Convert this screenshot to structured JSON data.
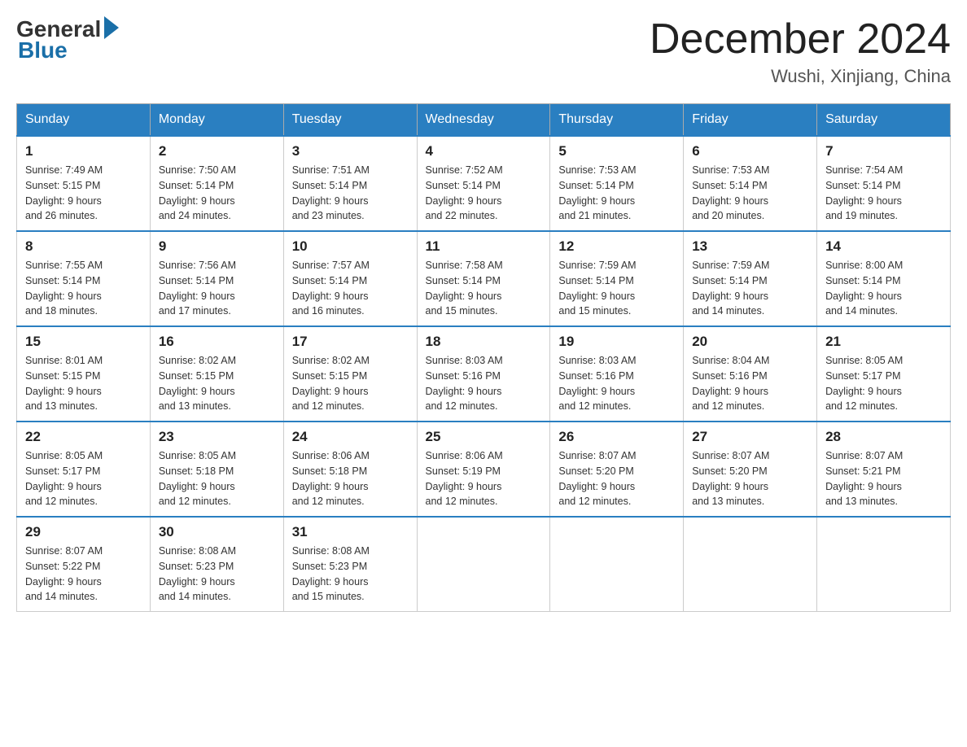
{
  "logo": {
    "general": "General",
    "blue": "Blue"
  },
  "title": "December 2024",
  "location": "Wushi, Xinjiang, China",
  "days_of_week": [
    "Sunday",
    "Monday",
    "Tuesday",
    "Wednesday",
    "Thursday",
    "Friday",
    "Saturday"
  ],
  "weeks": [
    [
      {
        "day": "1",
        "sunrise": "7:49 AM",
        "sunset": "5:15 PM",
        "daylight": "9 hours and 26 minutes."
      },
      {
        "day": "2",
        "sunrise": "7:50 AM",
        "sunset": "5:14 PM",
        "daylight": "9 hours and 24 minutes."
      },
      {
        "day": "3",
        "sunrise": "7:51 AM",
        "sunset": "5:14 PM",
        "daylight": "9 hours and 23 minutes."
      },
      {
        "day": "4",
        "sunrise": "7:52 AM",
        "sunset": "5:14 PM",
        "daylight": "9 hours and 22 minutes."
      },
      {
        "day": "5",
        "sunrise": "7:53 AM",
        "sunset": "5:14 PM",
        "daylight": "9 hours and 21 minutes."
      },
      {
        "day": "6",
        "sunrise": "7:53 AM",
        "sunset": "5:14 PM",
        "daylight": "9 hours and 20 minutes."
      },
      {
        "day": "7",
        "sunrise": "7:54 AM",
        "sunset": "5:14 PM",
        "daylight": "9 hours and 19 minutes."
      }
    ],
    [
      {
        "day": "8",
        "sunrise": "7:55 AM",
        "sunset": "5:14 PM",
        "daylight": "9 hours and 18 minutes."
      },
      {
        "day": "9",
        "sunrise": "7:56 AM",
        "sunset": "5:14 PM",
        "daylight": "9 hours and 17 minutes."
      },
      {
        "day": "10",
        "sunrise": "7:57 AM",
        "sunset": "5:14 PM",
        "daylight": "9 hours and 16 minutes."
      },
      {
        "day": "11",
        "sunrise": "7:58 AM",
        "sunset": "5:14 PM",
        "daylight": "9 hours and 15 minutes."
      },
      {
        "day": "12",
        "sunrise": "7:59 AM",
        "sunset": "5:14 PM",
        "daylight": "9 hours and 15 minutes."
      },
      {
        "day": "13",
        "sunrise": "7:59 AM",
        "sunset": "5:14 PM",
        "daylight": "9 hours and 14 minutes."
      },
      {
        "day": "14",
        "sunrise": "8:00 AM",
        "sunset": "5:14 PM",
        "daylight": "9 hours and 14 minutes."
      }
    ],
    [
      {
        "day": "15",
        "sunrise": "8:01 AM",
        "sunset": "5:15 PM",
        "daylight": "9 hours and 13 minutes."
      },
      {
        "day": "16",
        "sunrise": "8:02 AM",
        "sunset": "5:15 PM",
        "daylight": "9 hours and 13 minutes."
      },
      {
        "day": "17",
        "sunrise": "8:02 AM",
        "sunset": "5:15 PM",
        "daylight": "9 hours and 12 minutes."
      },
      {
        "day": "18",
        "sunrise": "8:03 AM",
        "sunset": "5:16 PM",
        "daylight": "9 hours and 12 minutes."
      },
      {
        "day": "19",
        "sunrise": "8:03 AM",
        "sunset": "5:16 PM",
        "daylight": "9 hours and 12 minutes."
      },
      {
        "day": "20",
        "sunrise": "8:04 AM",
        "sunset": "5:16 PM",
        "daylight": "9 hours and 12 minutes."
      },
      {
        "day": "21",
        "sunrise": "8:05 AM",
        "sunset": "5:17 PM",
        "daylight": "9 hours and 12 minutes."
      }
    ],
    [
      {
        "day": "22",
        "sunrise": "8:05 AM",
        "sunset": "5:17 PM",
        "daylight": "9 hours and 12 minutes."
      },
      {
        "day": "23",
        "sunrise": "8:05 AM",
        "sunset": "5:18 PM",
        "daylight": "9 hours and 12 minutes."
      },
      {
        "day": "24",
        "sunrise": "8:06 AM",
        "sunset": "5:18 PM",
        "daylight": "9 hours and 12 minutes."
      },
      {
        "day": "25",
        "sunrise": "8:06 AM",
        "sunset": "5:19 PM",
        "daylight": "9 hours and 12 minutes."
      },
      {
        "day": "26",
        "sunrise": "8:07 AM",
        "sunset": "5:20 PM",
        "daylight": "9 hours and 12 minutes."
      },
      {
        "day": "27",
        "sunrise": "8:07 AM",
        "sunset": "5:20 PM",
        "daylight": "9 hours and 13 minutes."
      },
      {
        "day": "28",
        "sunrise": "8:07 AM",
        "sunset": "5:21 PM",
        "daylight": "9 hours and 13 minutes."
      }
    ],
    [
      {
        "day": "29",
        "sunrise": "8:07 AM",
        "sunset": "5:22 PM",
        "daylight": "9 hours and 14 minutes."
      },
      {
        "day": "30",
        "sunrise": "8:08 AM",
        "sunset": "5:23 PM",
        "daylight": "9 hours and 14 minutes."
      },
      {
        "day": "31",
        "sunrise": "8:08 AM",
        "sunset": "5:23 PM",
        "daylight": "9 hours and 15 minutes."
      },
      null,
      null,
      null,
      null
    ]
  ],
  "labels": {
    "sunrise": "Sunrise:",
    "sunset": "Sunset:",
    "daylight": "Daylight:"
  }
}
